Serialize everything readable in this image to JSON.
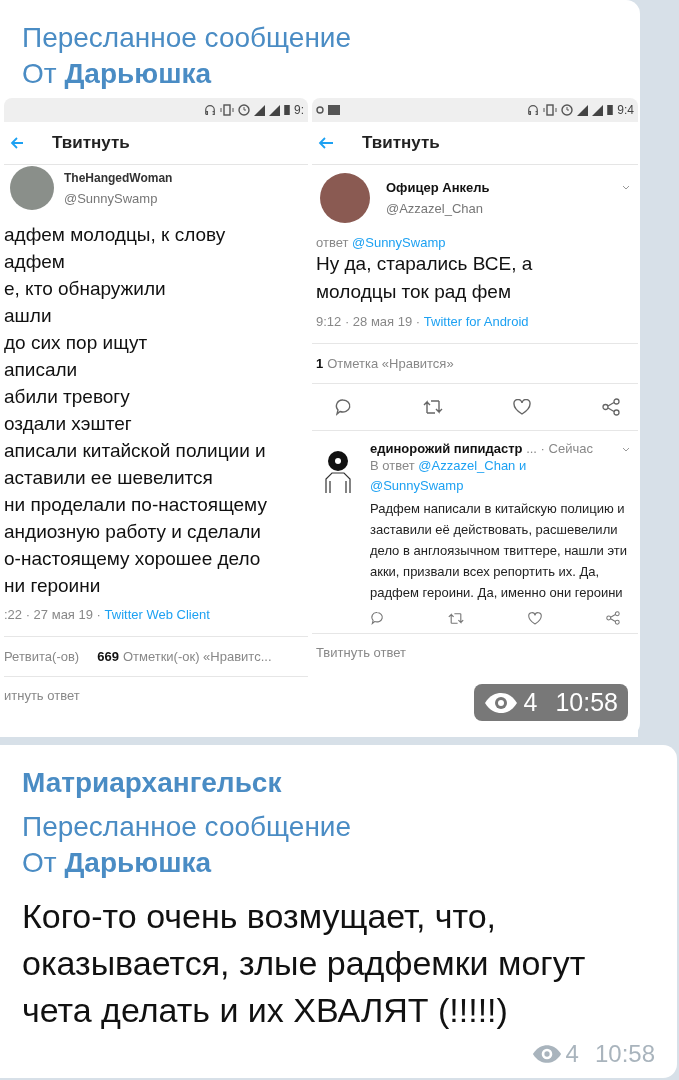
{
  "forwarded": {
    "label": "Пересланное сообщение",
    "from_prefix": "От",
    "from_name": "Дарьюшка"
  },
  "left_shot": {
    "status_time": "9:",
    "title": "Твитнуть",
    "author": "TheHangedWoman",
    "handle": "@SunnySwamp",
    "lines": [
      "адфем молодцы, к слову",
      "адфем",
      "е, кто обнаружили",
      "ашли",
      "до сих пор ищут",
      "аписали",
      "абили тревогу",
      "оздали хэштег",
      "аписали китайской полиции и",
      "аставили ее шевелится",
      "ни проделали по-настоящему",
      "андиозную работу и сделали",
      "о-настоящему хорошее дело",
      "ни героини"
    ],
    "time_date": ":22 · 27 мая 19 ·",
    "client": "Twitter Web Client",
    "retweets_label": "Ретвита(-ов)",
    "likes_count": "669",
    "likes_label": "Отметки(-ок) «Нравитс...",
    "reply_prompt": "итнуть ответ"
  },
  "right_shot": {
    "status_time": "9:4",
    "title": "Твитнуть",
    "author": "Офицер Анкель",
    "handle": "@Azzazel_Chan",
    "reply_prefix": "ответ",
    "reply_to": "@SunnySwamp",
    "text_lines": [
      "Ну да, старались ВСЕ, а",
      "молодцы ток рад фем"
    ],
    "time_date": "9:12 · 28 мая 19 ·",
    "client": "Twitter for Android",
    "likes_count": "1",
    "likes_label": "Отметка «Нравится»",
    "reply": {
      "author": "единорожий пипидастр",
      "ellipsis": "...",
      "time": "· Сейчас",
      "reply_prefix": "В ответ",
      "reply_to_lines": [
        "@Azzazel_Chan и",
        "@SunnySwamp"
      ],
      "text": "Радфем написали в китайскую полицию и заставили её действовать, расшевелили дело в англоязычном твиттере, нашли эти акки, призвали всех репортить их. Да, радфем героини. Да, именно они героини"
    },
    "reply_prompt": "Твитнуть ответ"
  },
  "meta": {
    "views": "4",
    "time": "10:58"
  },
  "message": {
    "sender": "Матриархангельск",
    "forwarded": {
      "label": "Пересланное сообщение",
      "from_prefix": "От",
      "from_name": "Дарьюшка"
    },
    "text": "Кого-то очень возмущает, что, оказывается, злые радфемки могут чета делать и их ХВАЛЯТ (!!!!!)",
    "views": "4",
    "time": "10:58"
  }
}
